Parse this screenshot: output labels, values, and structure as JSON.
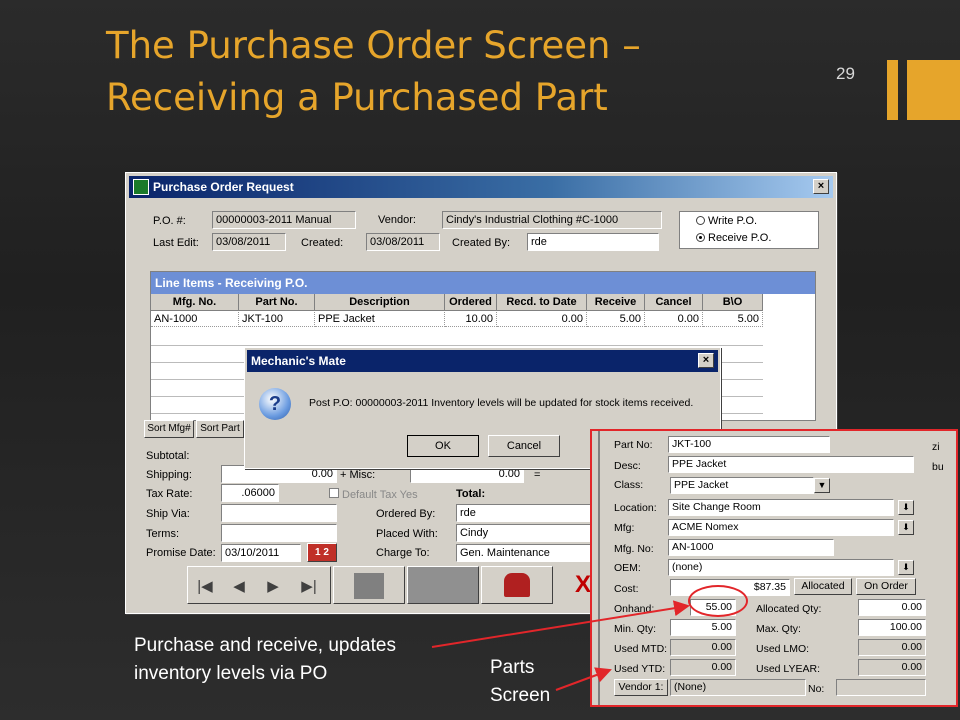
{
  "slide": {
    "title_line1": "The Purchase Order Screen –",
    "title_line2": "Receiving a Purchased Part",
    "number": "29"
  },
  "window": {
    "title": "Purchase Order Request",
    "close": "×"
  },
  "header": {
    "po_label": "P.O. #:",
    "po_value": "00000003-2011 Manual",
    "vendor_label": "Vendor:",
    "vendor_value": "Cindy's Industrial Clothing #C-1000",
    "last_edit_label": "Last Edit:",
    "last_edit_value": "03/08/2011",
    "created_label": "Created:",
    "created_value": "03/08/2011",
    "created_by_label": "Created By:",
    "created_by_value": "rde",
    "write_po": "Write P.O.",
    "receive_po": "Receive P.O."
  },
  "line_items": {
    "title": "Line Items - Receiving P.O.",
    "columns": [
      "Mfg. No.",
      "Part No.",
      "Description",
      "Ordered",
      "Recd. to Date",
      "Receive",
      "Cancel",
      "B\\O"
    ],
    "rows": [
      [
        "AN-1000",
        "JKT-100",
        "PPE Jacket",
        "10.00",
        "0.00",
        "5.00",
        "0.00",
        "5.00"
      ]
    ]
  },
  "sort": {
    "mfg": "Sort Mfg#",
    "part": "Sort Part"
  },
  "totals": {
    "subtotal_label": "Subtotal:",
    "shipping_label": "Shipping:",
    "shipping_value": "0.00",
    "misc_label": "+ Misc:",
    "misc_value": "0.00",
    "eq": "=",
    "tax_rate_label": "Tax Rate:",
    "tax_rate_value": ".06000",
    "default_tax": "Default Tax Yes",
    "total_label": "Total:",
    "ship_via_label": "Ship Via:",
    "terms_label": "Terms:",
    "promise_label": "Promise Date:",
    "promise_value": "03/10/2011",
    "cal": "1 2",
    "ordered_by_label": "Ordered By:",
    "ordered_by_value": "rde",
    "placed_with_label": "Placed With:",
    "placed_with_value": "Cindy",
    "charge_to_label": "Charge To:",
    "charge_to_value": "Gen. Maintenance"
  },
  "dialog": {
    "title": "Mechanic's Mate",
    "close": "×",
    "icon": "?",
    "message": "Post P.O: 00000003-2011 Inventory levels will be updated for stock items received.",
    "ok": "OK",
    "cancel": "Cancel"
  },
  "parts": {
    "part_no_label": "Part No:",
    "part_no": "JKT-100",
    "desc_label": "Desc:",
    "desc": "PPE Jacket",
    "class_label": "Class:",
    "class": "PPE Jacket",
    "location_label": "Location:",
    "location": "Site Change Room",
    "mfg_label": "Mfg:",
    "mfg": "ACME Nomex",
    "mfg_no_label": "Mfg. No:",
    "mfg_no": "AN-1000",
    "oem_label": "OEM:",
    "oem": "(none)",
    "cost_label": "Cost:",
    "cost": "$87.35",
    "allocated_btn": "Allocated",
    "on_order_btn": "On Order",
    "onhand_label": "Onhand:",
    "onhand": "55.00",
    "alloc_qty_label": "Allocated Qty:",
    "alloc_qty": "0.00",
    "min_qty_label": "Min. Qty:",
    "min_qty": "5.00",
    "max_qty_label": "Max. Qty:",
    "max_qty": "100.00",
    "used_mtd_label": "Used MTD:",
    "used_mtd": "0.00",
    "used_lmo_label": "Used LMO:",
    "used_lmo": "0.00",
    "used_ytd_label": "Used YTD:",
    "used_ytd": "0.00",
    "used_lyear_label": "Used LYEAR:",
    "used_lyear": "0.00",
    "vendor1_btn": "Vendor 1:",
    "vendor1": "(None)",
    "no_label": "No:",
    "zip": "zi",
    "bu": "bu"
  },
  "callouts": {
    "left_line1": "Purchase and receive, updates",
    "left_line2": "inventory levels via PO",
    "right_line1": "Parts",
    "right_line2": "Screen"
  },
  "colors": {
    "accent": "#e6a52b",
    "highlight": "#e2262a",
    "titlebar": "#0a246a",
    "grid_title": "#6d8fd6"
  }
}
